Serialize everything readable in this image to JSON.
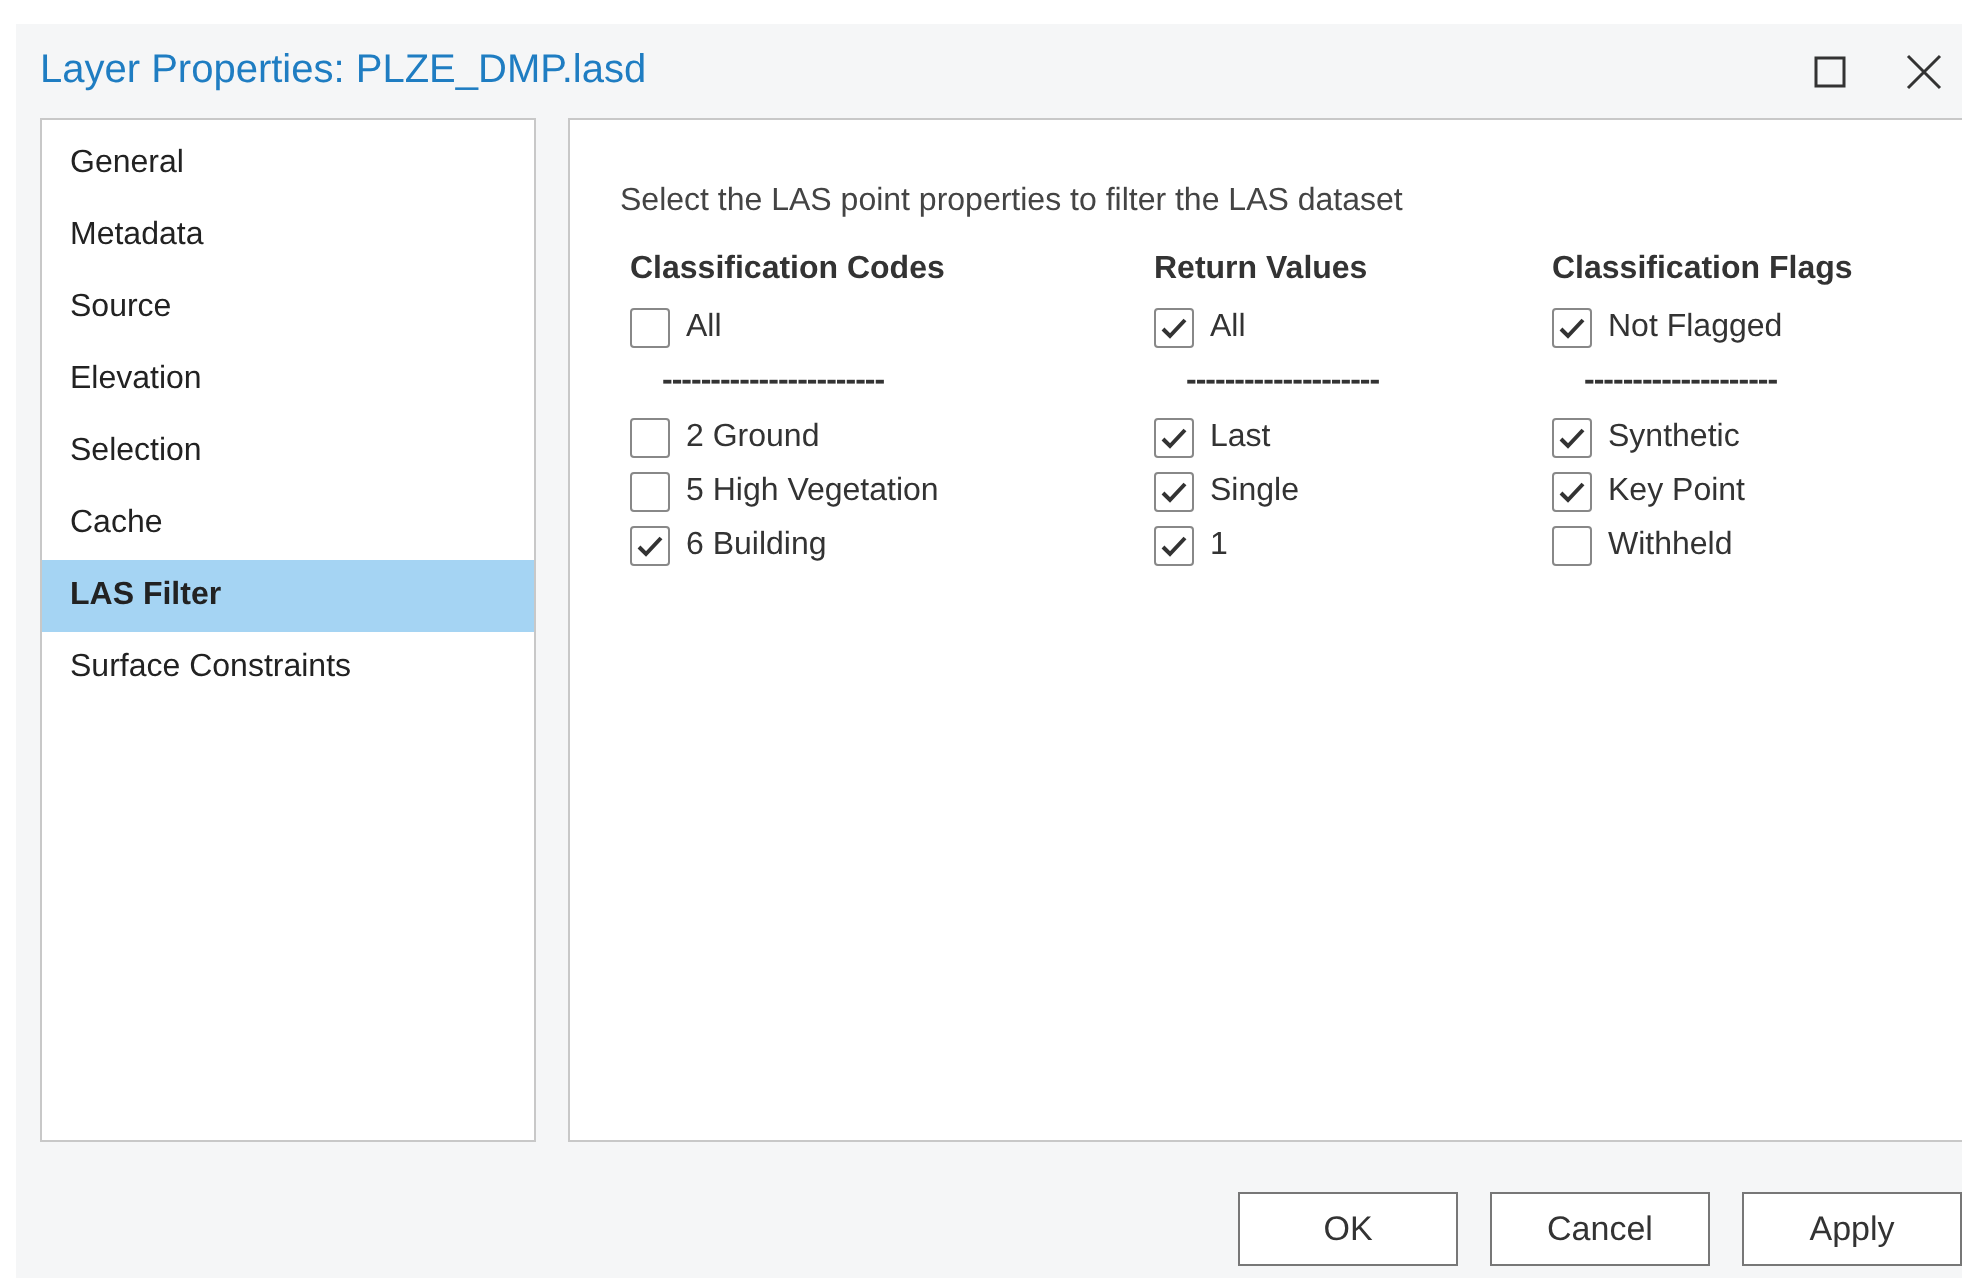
{
  "window": {
    "title": "Layer Properties: PLZE_DMP.lasd"
  },
  "sidebar": {
    "items": [
      {
        "label": "General",
        "selected": false
      },
      {
        "label": "Metadata",
        "selected": false
      },
      {
        "label": "Source",
        "selected": false
      },
      {
        "label": "Elevation",
        "selected": false
      },
      {
        "label": "Selection",
        "selected": false
      },
      {
        "label": "Cache",
        "selected": false
      },
      {
        "label": "LAS Filter",
        "selected": true
      },
      {
        "label": "Surface Constraints",
        "selected": false
      }
    ]
  },
  "content": {
    "intro": "Select the LAS point properties to filter the LAS dataset",
    "groups": [
      {
        "heading": "Classification Codes",
        "all": {
          "label": "All",
          "checked": false
        },
        "separator": "-----------------------",
        "items": [
          {
            "label": "2 Ground",
            "checked": false
          },
          {
            "label": "5 High Vegetation",
            "checked": false
          },
          {
            "label": "6 Building",
            "checked": true
          }
        ]
      },
      {
        "heading": "Return Values",
        "all": {
          "label": "All",
          "checked": true
        },
        "separator": "--------------------",
        "items": [
          {
            "label": "Last",
            "checked": true
          },
          {
            "label": "Single",
            "checked": true
          },
          {
            "label": "1",
            "checked": true
          }
        ]
      },
      {
        "heading": "Classification Flags",
        "all": {
          "label": "Not Flagged",
          "checked": true
        },
        "separator": "--------------------",
        "items": [
          {
            "label": "Synthetic",
            "checked": true
          },
          {
            "label": "Key Point",
            "checked": true
          },
          {
            "label": "Withheld",
            "checked": false
          }
        ]
      }
    ]
  },
  "buttons": [
    "OK",
    "Cancel",
    "Apply"
  ]
}
